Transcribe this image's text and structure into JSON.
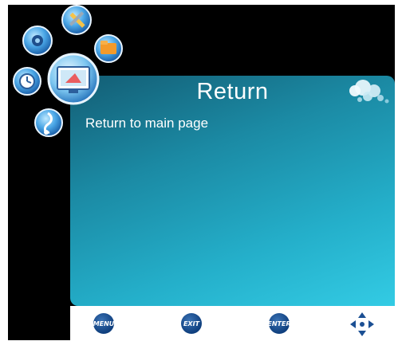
{
  "panel": {
    "title": "Return",
    "description": "Return to main page"
  },
  "footer": {
    "menu_label": "MENU",
    "exit_label": "EXIT",
    "enter_label": "ENTER",
    "navigation_icon": "four-way-arrows-icon"
  },
  "launcher_icons": [
    "gear-icon",
    "tools-icon",
    "folder-icon",
    "display-icon",
    "clock-icon",
    "music-note-icon"
  ],
  "colors": {
    "panel_dark": "#135d74",
    "panel_light": "#33cbe4",
    "button_blue": "#0f3f7e"
  }
}
